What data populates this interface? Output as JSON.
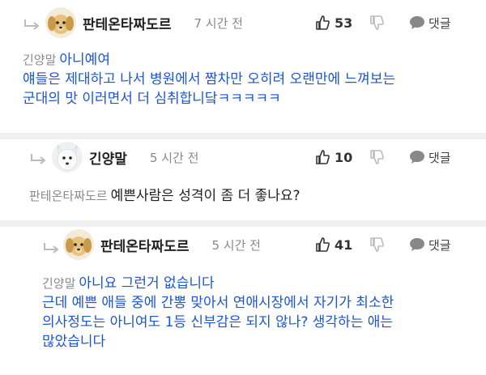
{
  "comments": [
    {
      "author": "판테온타짜도르",
      "time": "7 시간 전",
      "likes": "53",
      "reply_label": "댓글",
      "mention": "긴양말",
      "first_line": "아니예여",
      "lines": [
        "얘들은 제대하고 나서 병원에서 짬차만 오히려 오랜만에 느껴보는",
        "군대의 맛 이러면서 더 심취합니닼ㅋㅋㅋㅋㅋ"
      ],
      "avatar_icon": "puppy-icon"
    },
    {
      "author": "긴양말",
      "time": "5 시간 전",
      "likes": "10",
      "reply_label": "댓글",
      "mention": "판테온타짜도르",
      "first_line": "예쁜사람은 성격이 좀 더 좋나요?",
      "lines": [],
      "avatar_icon": "white-dog-icon"
    },
    {
      "author": "판테온타짜도르",
      "time": "5 시간 전",
      "likes": "41",
      "reply_label": "댓글",
      "mention": "긴양말",
      "first_line": "아니요 그런거 없습니다",
      "lines": [
        "근데 예쁜 애들 중에 간뽕 맞아서 연애시장에서 자기가 최소한",
        "의사정도는 아니여도 1등 신부감은 되지 않나? 생각하는 애는",
        "많았습니다"
      ],
      "avatar_icon": "puppy-icon"
    }
  ],
  "colors": {
    "reply_text": "#1a55d6",
    "mention": "#8a8a8a",
    "separator": "#f0f0f0"
  }
}
